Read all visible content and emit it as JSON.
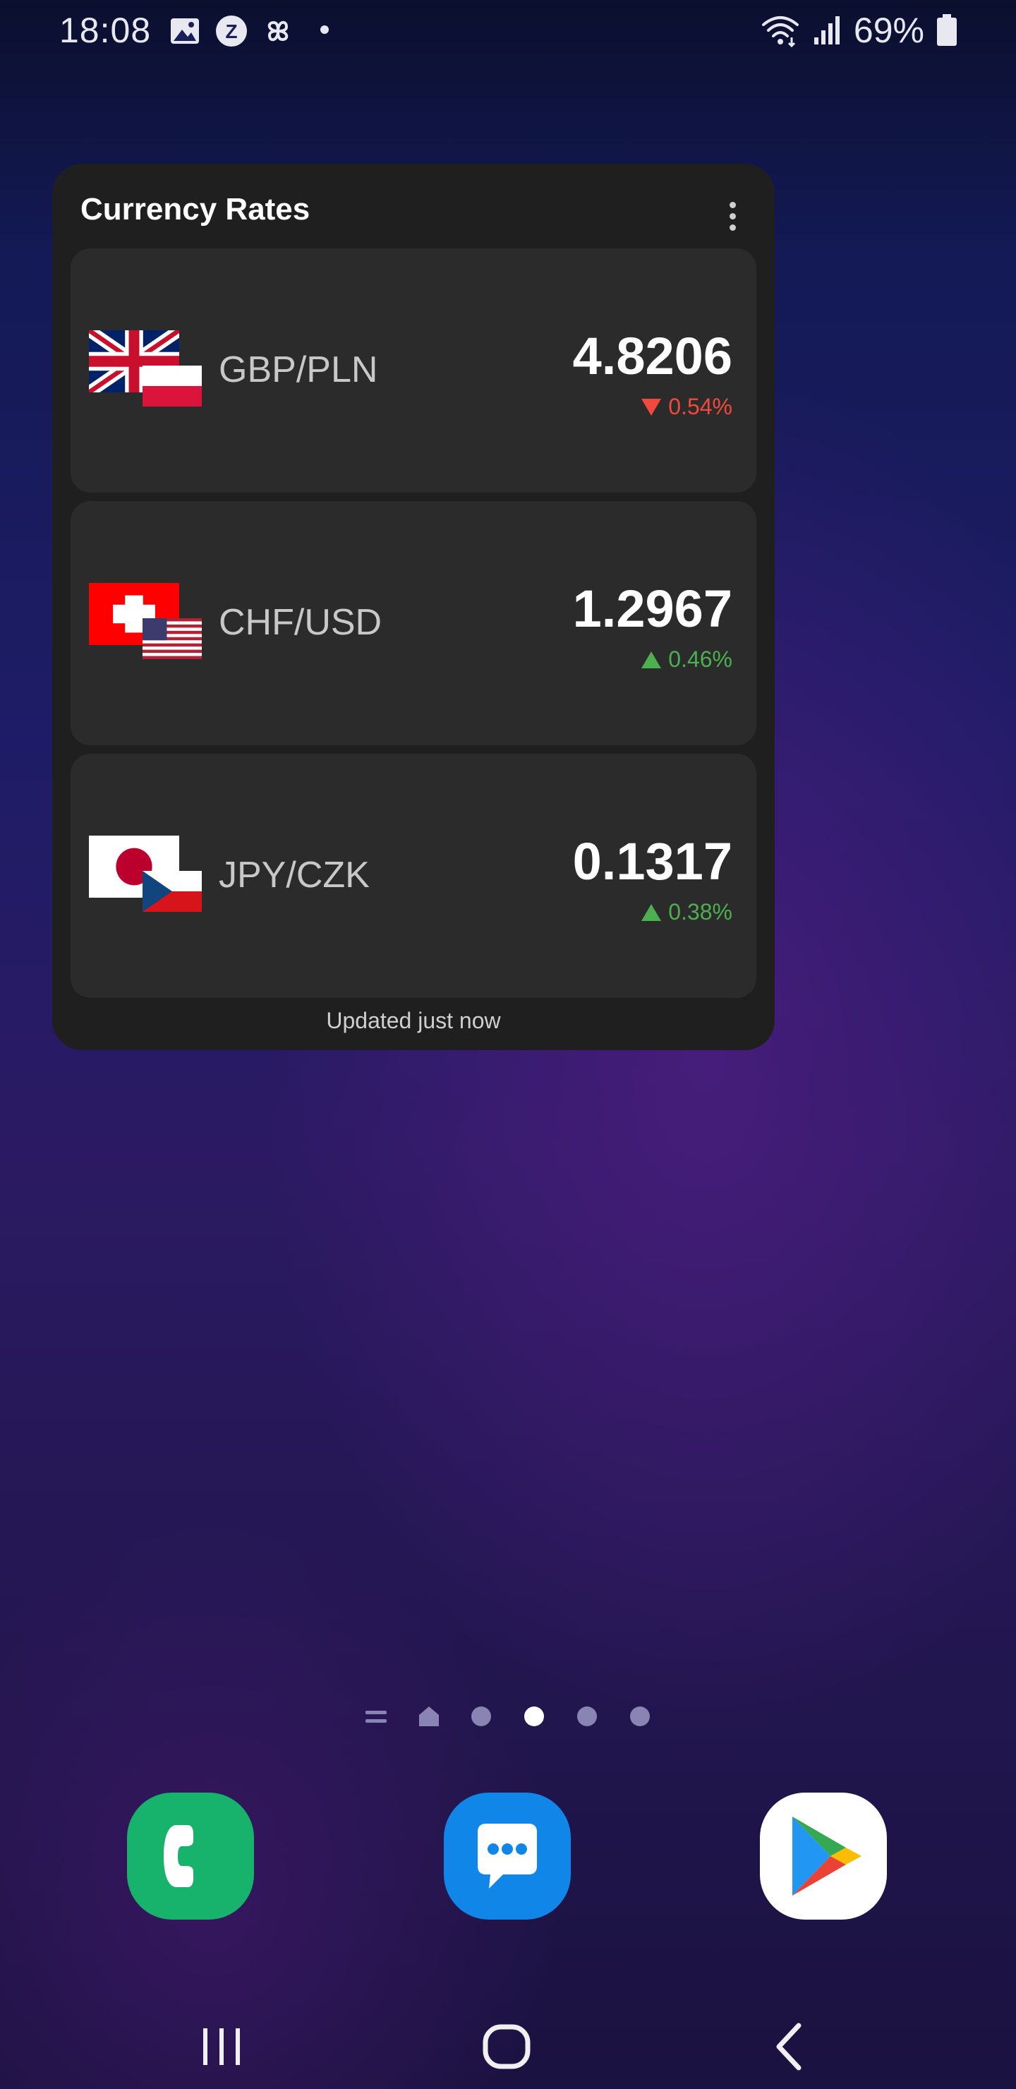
{
  "status_bar": {
    "time": "18:08",
    "battery_percent": "69%",
    "icons_left": [
      "image-icon",
      "z-app-icon",
      "pinwheel-icon",
      "dot-icon"
    ],
    "icons_right": [
      "wifi-icon",
      "signal-icon",
      "battery-icon"
    ]
  },
  "widget": {
    "title": "Currency Rates",
    "updated_text": "Updated just now",
    "rates": [
      {
        "pair": "GBP/PLN",
        "value": "4.8206",
        "change": "0.54%",
        "direction": "down",
        "flags": [
          "uk-flag-icon",
          "poland-flag-icon"
        ]
      },
      {
        "pair": "CHF/USD",
        "value": "1.2967",
        "change": "0.46%",
        "direction": "up",
        "flags": [
          "switzerland-flag-icon",
          "usa-flag-icon"
        ]
      },
      {
        "pair": "JPY/CZK",
        "value": "0.1317",
        "change": "0.38%",
        "direction": "up",
        "flags": [
          "japan-flag-icon",
          "czech-flag-icon"
        ]
      }
    ]
  },
  "pager": {
    "items": [
      "menu",
      "home",
      "page",
      "page",
      "page",
      "page"
    ],
    "active_index": 3
  },
  "dock": {
    "apps": [
      "phone-app-icon",
      "messages-app-icon",
      "play-store-app-icon"
    ]
  },
  "colors": {
    "down": "#f04a3e",
    "up": "#4caf50",
    "widget_bg": "#1f1f1f",
    "card_bg": "#2b2b2b"
  }
}
